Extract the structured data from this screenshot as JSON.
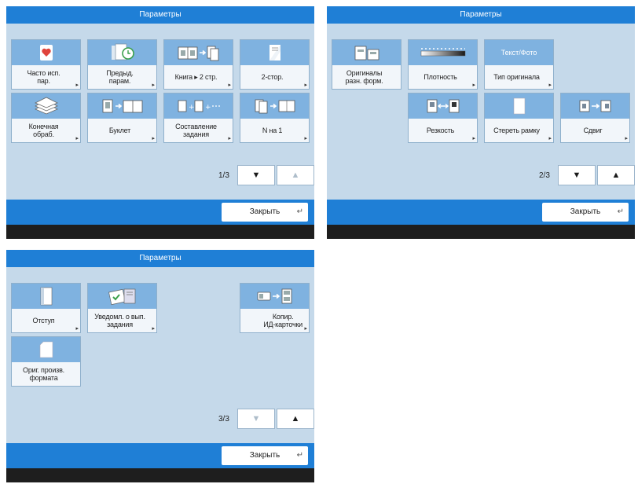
{
  "panels": [
    {
      "title": "Параметры",
      "tiles": [
        {
          "label": "Часто исп.\nпар.",
          "icon": "heart-document-icon"
        },
        {
          "label": "Предыд.\nпарам.",
          "icon": "clock-document-icon"
        },
        {
          "label": "Книга ▸ 2 стр.",
          "icon": "book-to-pages-icon"
        },
        {
          "label": "2-стор.",
          "icon": "two-sided-icon"
        },
        {
          "label": "Конечная\nобраб.",
          "icon": "finishing-stack-icon"
        },
        {
          "label": "Буклет",
          "icon": "booklet-icon"
        },
        {
          "label": "Составление\nзадания",
          "icon": "job-build-icon"
        },
        {
          "label": "N на 1",
          "icon": "n-on-1-icon"
        }
      ],
      "page": "1/3",
      "down": "▼",
      "up": "▲",
      "close": "Закрыть",
      "enter": "↵"
    },
    {
      "title": "Параметры",
      "tiles": [
        {
          "label": "Оригиналы\nразн. форм.",
          "icon": "mixed-originals-icon"
        },
        {
          "label": "Плотность",
          "icon": "density-slider-icon"
        },
        {
          "label": "Тип оригинала",
          "icon": "text-photo-icon",
          "icon_text": "Текст/Фото"
        },
        {
          "label": "Резкость",
          "icon": "sharpness-icon"
        },
        {
          "label": "Стереть рамку",
          "icon": "erase-frame-icon"
        },
        {
          "label": "Сдвиг",
          "icon": "shift-icon"
        }
      ],
      "page": "2/3",
      "down": "▼",
      "up": "▲",
      "close": "Закрыть",
      "enter": "↵"
    },
    {
      "title": "Параметры",
      "tiles": [
        {
          "label": "Отступ",
          "icon": "margin-icon"
        },
        {
          "label": "Уведомл. о вып.\nзадания",
          "icon": "job-notify-icon"
        },
        {
          "label": "Копир.\nИД-карточки",
          "icon": "id-card-copy-icon"
        },
        {
          "label": "Ориг. произв.\nформата",
          "icon": "free-size-original-icon"
        }
      ],
      "page": "3/3",
      "down": "▼",
      "up": "▲",
      "close": "Закрыть",
      "enter": "↵"
    }
  ]
}
